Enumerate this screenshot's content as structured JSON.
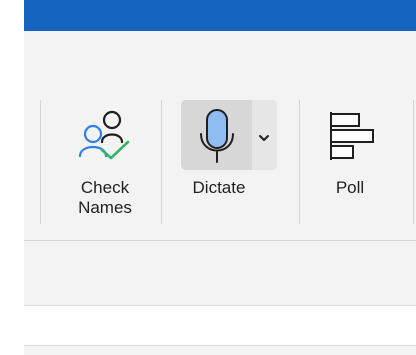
{
  "ribbon": {
    "buttons": [
      {
        "label": "Check\nNames",
        "icon": "check-names-icon"
      },
      {
        "label": "Dictate",
        "icon": "microphone-icon",
        "dropdown_icon": "chevron-down-icon"
      },
      {
        "label": "Poll",
        "icon": "poll-icon"
      }
    ]
  },
  "colors": {
    "title_bar": "#1565c0",
    "ribbon_bg": "#f3f3f3",
    "icon_stroke": "#1f1f1f",
    "check_green": "#35b36a",
    "person_blue": "#2f7fe6",
    "mic_fill": "#8fbdf2"
  }
}
